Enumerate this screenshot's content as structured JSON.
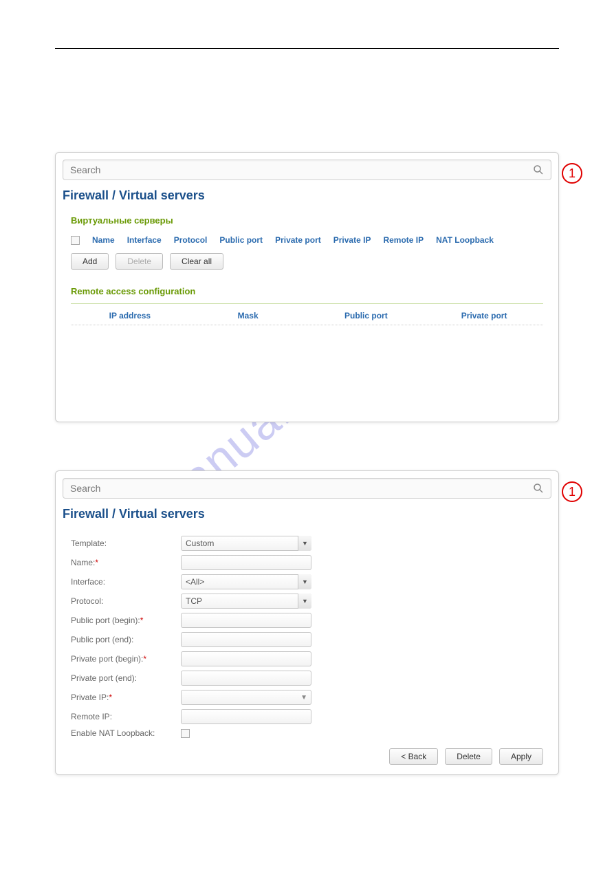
{
  "watermark": "manualshive.com",
  "badge": "1",
  "search": {
    "placeholder": "Search"
  },
  "breadcrumb": "Firewall /  Virtual servers",
  "panel1": {
    "sectionA": "Виртуальные серверы",
    "headers": [
      "Name",
      "Interface",
      "Protocol",
      "Public port",
      "Private port",
      "Private IP",
      "Remote IP",
      "NAT Loopback"
    ],
    "buttons": {
      "add": "Add",
      "delete": "Delete",
      "clearall": "Clear all"
    },
    "sectionB": "Remote access configuration",
    "remote_headers": [
      "IP address",
      "Mask",
      "Public port",
      "Private port"
    ]
  },
  "panel2": {
    "fields": {
      "template": {
        "label": "Template:",
        "value": "Custom"
      },
      "name": {
        "label": "Name:"
      },
      "interface": {
        "label": "Interface:",
        "value": "<All>"
      },
      "protocol": {
        "label": "Protocol:",
        "value": "TCP"
      },
      "pub_begin": {
        "label": "Public port (begin):"
      },
      "pub_end": {
        "label": "Public port (end):"
      },
      "priv_begin": {
        "label": "Private port (begin):"
      },
      "priv_end": {
        "label": "Private port (end):"
      },
      "priv_ip": {
        "label": "Private IP:"
      },
      "remote_ip": {
        "label": "Remote IP:"
      },
      "nat": {
        "label": "Enable NAT Loopback:"
      }
    },
    "buttons": {
      "back": "< Back",
      "delete": "Delete",
      "apply": "Apply"
    }
  }
}
